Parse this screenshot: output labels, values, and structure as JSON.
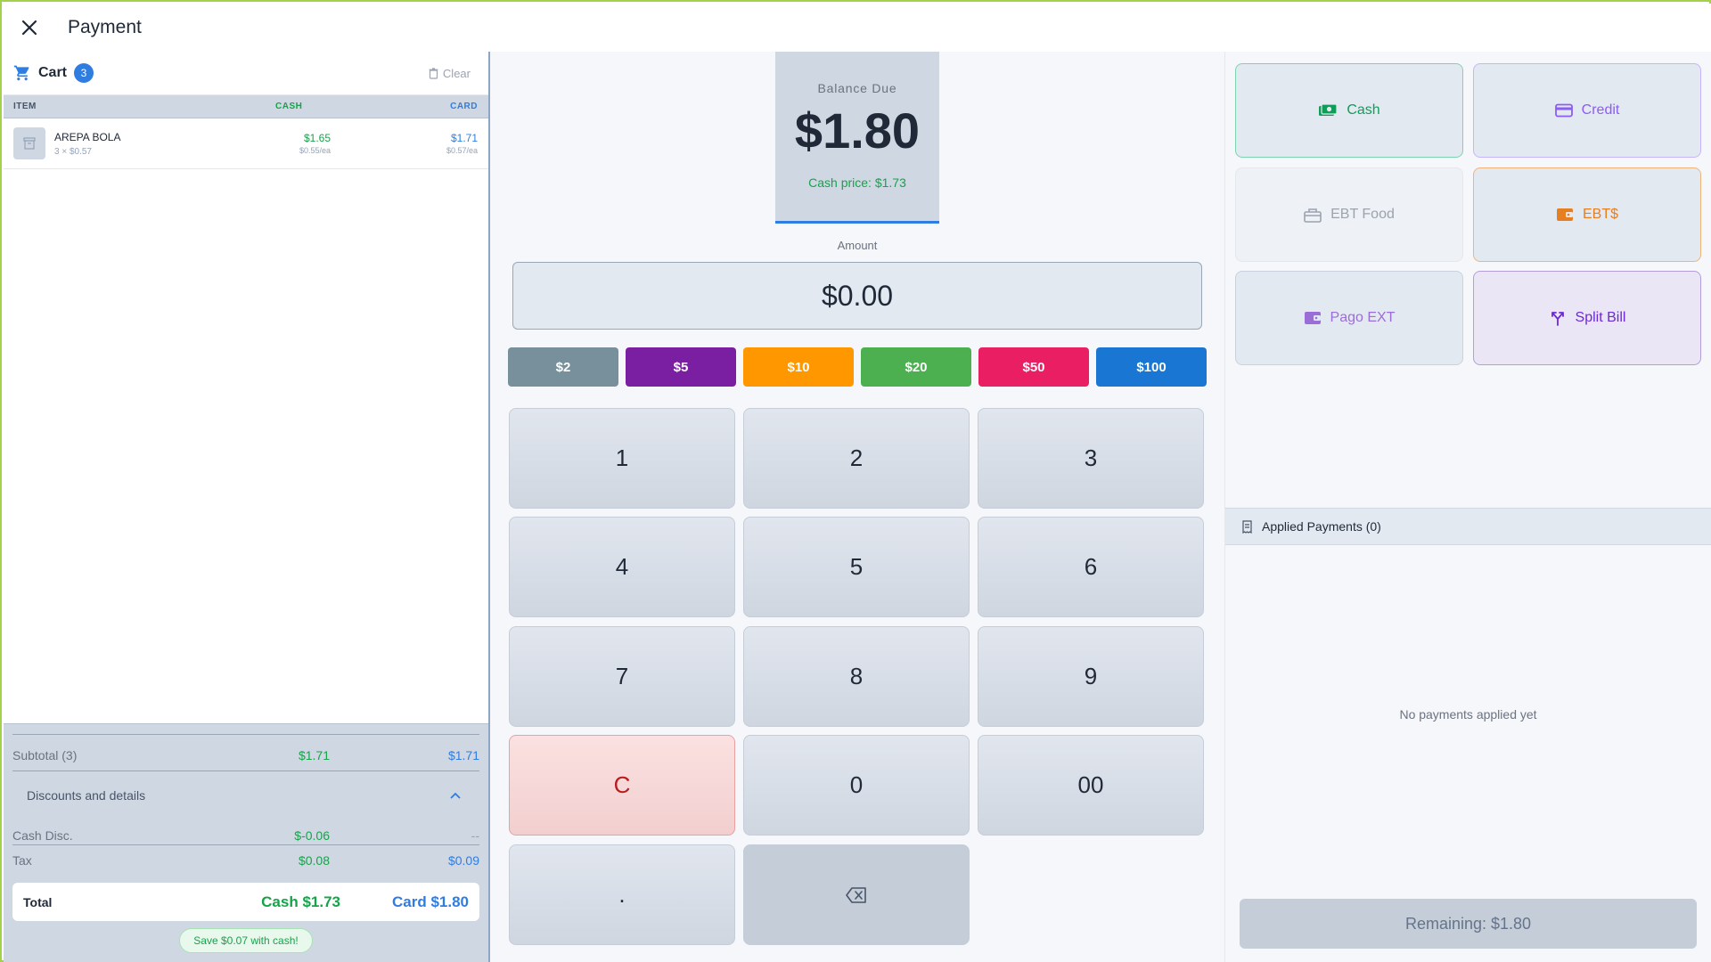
{
  "header": {
    "title": "Payment"
  },
  "cart": {
    "label": "Cart",
    "count": "3",
    "clear_label": "Clear",
    "columns": {
      "item": "ITEM",
      "cash": "CASH",
      "card": "CARD"
    },
    "items": [
      {
        "name": "AREPA BOLA",
        "qty_price": "3 × $0.57",
        "cash": "$1.65",
        "cash_each": "$0.55/ea",
        "card": "$1.71",
        "card_each": "$0.57/ea"
      }
    ]
  },
  "summary": {
    "subtotal_label": "Subtotal (3)",
    "subtotal_cash": "$1.71",
    "subtotal_card": "$1.71",
    "discounts_label": "Discounts and details",
    "cash_disc_label": "Cash Disc.",
    "cash_disc_cash": "$-0.06",
    "cash_disc_card": "--",
    "tax_label": "Tax",
    "tax_cash": "$0.08",
    "tax_card": "$0.09",
    "total_label": "Total",
    "total_cash": "Cash $1.73",
    "total_card": "Card $1.80",
    "save_message": "Save $0.07 with cash!"
  },
  "balance": {
    "label": "Balance Due",
    "amount": "$1.80",
    "cash_price": "Cash price: $1.73"
  },
  "amount": {
    "label": "Amount",
    "value": "$0.00"
  },
  "quick_amounts": [
    {
      "label": "$2",
      "color": "#78909c"
    },
    {
      "label": "$5",
      "color": "#7b1fa2"
    },
    {
      "label": "$10",
      "color": "#ff9800"
    },
    {
      "label": "$20",
      "color": "#4caf50"
    },
    {
      "label": "$50",
      "color": "#e91e63"
    },
    {
      "label": "$100",
      "color": "#1976d2"
    }
  ],
  "keypad": [
    "1",
    "2",
    "3",
    "4",
    "5",
    "6",
    "7",
    "8",
    "9",
    "C",
    "0",
    "00",
    "."
  ],
  "methods": [
    {
      "label": "Cash",
      "icon": "cash-icon",
      "color": "#0f9d58"
    },
    {
      "label": "Credit",
      "icon": "credit-card-icon",
      "color": "#8b5cf6"
    },
    {
      "label": "EBT Food",
      "icon": "ebt-food-icon",
      "color": "#9ca3af"
    },
    {
      "label": "EBT$",
      "icon": "wallet-icon",
      "color": "#e67e22"
    },
    {
      "label": "Pago EXT",
      "icon": "wallet-icon",
      "color": "#9b6dd6"
    },
    {
      "label": "Split Bill",
      "icon": "split-icon",
      "color": "#6d28d9"
    }
  ],
  "applied": {
    "label": "Applied Payments (0)",
    "empty_message": "No payments applied yet",
    "remaining": "Remaining: $1.80"
  }
}
